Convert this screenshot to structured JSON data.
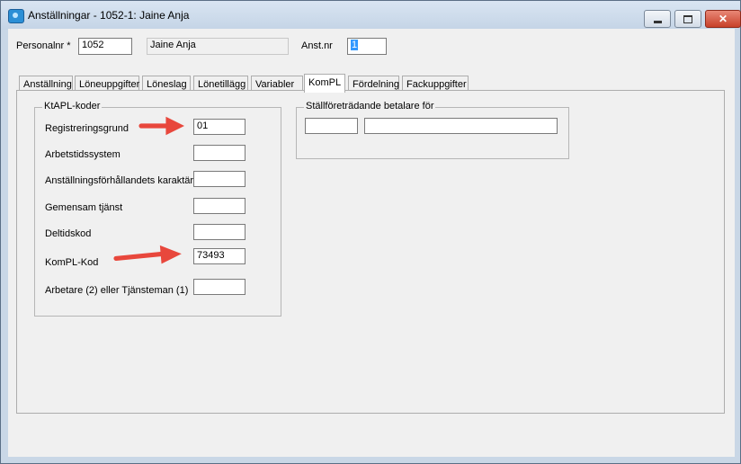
{
  "window": {
    "title": "Anställningar - 1052-1: Jaine Anja",
    "icon": "app-icon",
    "buttons": {
      "minimize_icon": "minimize-icon",
      "maximize_icon": "maximize-icon",
      "close_icon": "close-icon",
      "close_glyph": "✕"
    }
  },
  "header": {
    "personalnr_label": "Personalnr *",
    "personalnr_value": "1052",
    "name_value": "Jaine Anja",
    "anstnr_label": "Anst.nr",
    "anstnr_value": "1"
  },
  "tabs": [
    {
      "label": "Anställning"
    },
    {
      "label": "Löneuppgifter"
    },
    {
      "label": "Löneslag"
    },
    {
      "label": "Lönetillägg"
    },
    {
      "label": "Variabler"
    },
    {
      "label": "KomPL",
      "active": true
    },
    {
      "label": "Fördelning"
    },
    {
      "label": "Fackuppgifter"
    }
  ],
  "ktapl": {
    "title": "KtAPL-koder",
    "fields": [
      {
        "label": "Registreringsgrund",
        "value": "01"
      },
      {
        "label": "Arbetstidssystem",
        "value": ""
      },
      {
        "label": "Anställningsförhållandets karaktär",
        "value": ""
      },
      {
        "label": "Gemensam tjänst",
        "value": ""
      },
      {
        "label": "Deltidskod",
        "value": ""
      },
      {
        "label": "KomPL-Kod",
        "value": "73493"
      },
      {
        "label": "Arbetare (2) eller Tjänsteman (1)",
        "value": ""
      }
    ]
  },
  "stallforetradande": {
    "title": "Ställföreträdande betalare för",
    "code_value": "",
    "name_value": ""
  },
  "annotations": {
    "arrow_color": "#e8473c"
  }
}
